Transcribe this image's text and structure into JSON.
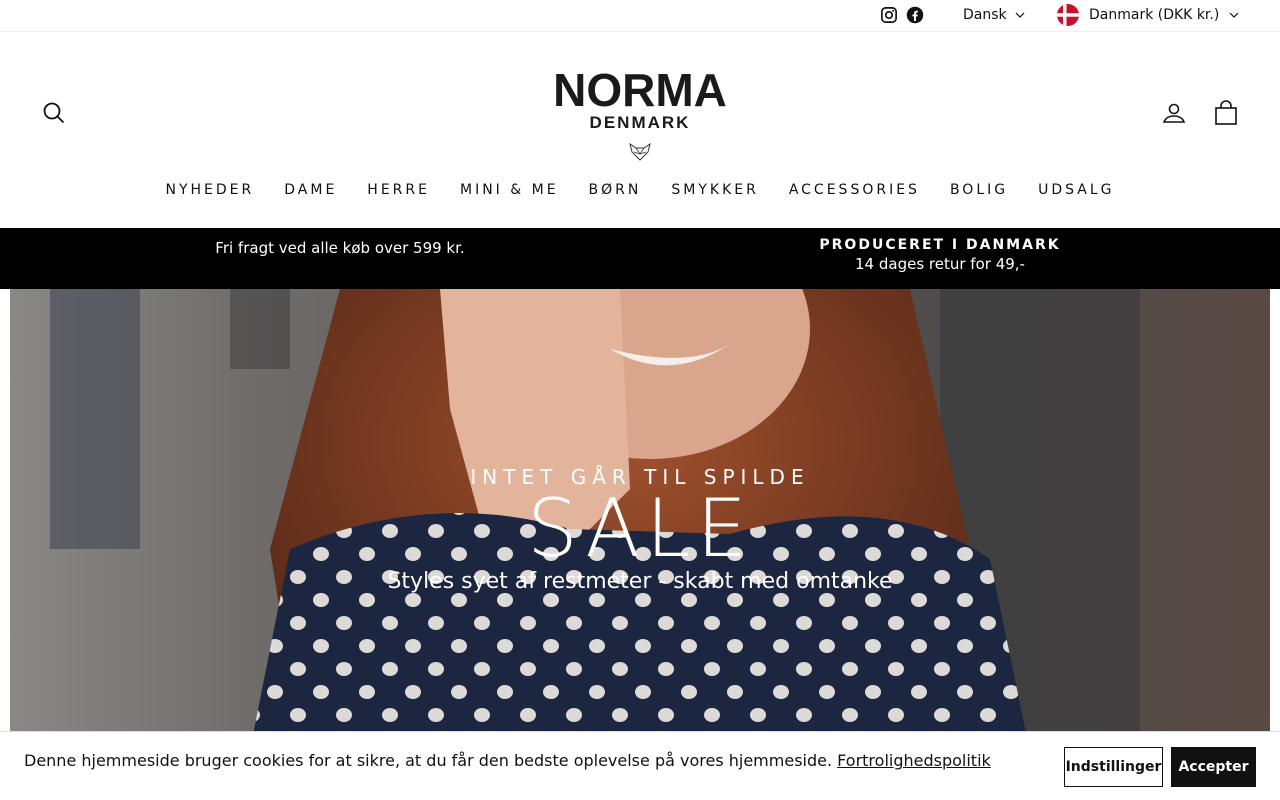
{
  "topbar": {
    "social": [
      {
        "icon": "instagram-icon"
      },
      {
        "icon": "facebook-icon"
      }
    ],
    "language": "Dansk",
    "country": "Danmark (DKK kr.)",
    "country_flag": "denmark-flag-icon"
  },
  "header": {
    "logo_line1": "NORMA",
    "logo_line2": "DENMARK",
    "icons": [
      "search-icon",
      "account-icon",
      "cart-icon"
    ],
    "nav": [
      "NYHEDER",
      "DAME",
      "HERRE",
      "MINI & ME",
      "BØRN",
      "SMYKKER",
      "ACCESSORIES",
      "BOLIG",
      "UDSALG"
    ]
  },
  "announcement": {
    "left": "Fri fragt ved alle køb over 599 kr.",
    "right_title": "PRODUCERET I DANMARK",
    "right_text": "14 dages retur for 49,-"
  },
  "hero": {
    "subtitle": "INTET GÅR TIL SPILDE",
    "title": "SALE",
    "description": "Styles syet af restmeter - skabt med omtanke"
  },
  "cookie": {
    "text": "Denne hjemmeside bruger cookies for at sikre, at du får den bedste oplevelse på vores hjemmeside.",
    "link": "Fortrolighedspolitik",
    "settings_label": "Indstillinger",
    "accept_label": "Accepter"
  },
  "colors": {
    "announcement_bg": "#000000",
    "flag_red": "#c8102e"
  }
}
